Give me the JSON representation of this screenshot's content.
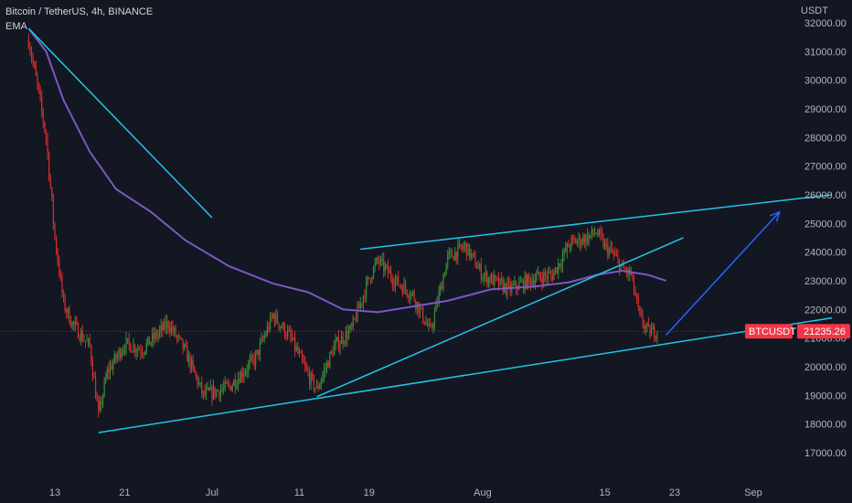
{
  "header": {
    "symbol_line": "Bitcoin / TetherUS, 4h, BINANCE",
    "indicator": "EMA"
  },
  "price_axis_unit": "USDT",
  "price_badge": {
    "symbol": "BTCUSDT",
    "price": "21235.26",
    "color": "#f23645"
  },
  "colors": {
    "background": "#131722",
    "up_candle": "#26a69a",
    "up_candle_wick": "#3a8a3a",
    "down_candle": "#d32f2f",
    "ema_line": "#7e57c2",
    "trend_lines": "#22c4e6",
    "arrow": "#2962ff"
  },
  "chart_data": {
    "type": "candlestick",
    "y_axis": {
      "ylim": [
        16200,
        32700
      ],
      "ticks": [
        "32000.00",
        "31000.00",
        "30000.00",
        "29000.00",
        "28000.00",
        "27000.00",
        "26000.00",
        "25000.00",
        "24000.00",
        "23000.00",
        "22000.00",
        "21000.00",
        "20000.00",
        "19000.00",
        "18000.00",
        "17000.00"
      ]
    },
    "x_axis": {
      "tick_labels": [
        "13",
        "21",
        "Jul",
        "11",
        "19",
        "Aug",
        "15",
        "23",
        "Sep"
      ]
    },
    "price_path": [
      {
        "t": "Jun 10",
        "p": 31400
      },
      {
        "t": "Jun 11",
        "p": 29800
      },
      {
        "t": "Jun 12",
        "p": 28000
      },
      {
        "t": "Jun 13",
        "p": 24500
      },
      {
        "t": "Jun 14",
        "p": 22200
      },
      {
        "t": "Jun 15",
        "p": 21500
      },
      {
        "t": "Jun 17",
        "p": 20700
      },
      {
        "t": "Jun 18",
        "p": 18300
      },
      {
        "t": "Jun 19",
        "p": 19800
      },
      {
        "t": "Jun 21",
        "p": 20800
      },
      {
        "t": "Jun 23",
        "p": 20600
      },
      {
        "t": "Jun 26",
        "p": 21500
      },
      {
        "t": "Jun 28",
        "p": 20500
      },
      {
        "t": "Jun 30",
        "p": 19000
      },
      {
        "t": "Jul 3",
        "p": 19300
      },
      {
        "t": "Jul 6",
        "p": 20300
      },
      {
        "t": "Jul 8",
        "p": 21800
      },
      {
        "t": "Jul 10",
        "p": 21000
      },
      {
        "t": "Jul 12",
        "p": 19700
      },
      {
        "t": "Jul 13",
        "p": 19200
      },
      {
        "t": "Jul 15",
        "p": 20700
      },
      {
        "t": "Jul 17",
        "p": 21300
      },
      {
        "t": "Jul 19",
        "p": 23100
      },
      {
        "t": "Jul 20",
        "p": 23700
      },
      {
        "t": "Jul 22",
        "p": 23000
      },
      {
        "t": "Jul 24",
        "p": 22500
      },
      {
        "t": "Jul 26",
        "p": 21200
      },
      {
        "t": "Jul 28",
        "p": 23800
      },
      {
        "t": "Jul 30",
        "p": 24200
      },
      {
        "t": "Aug 1",
        "p": 23200
      },
      {
        "t": "Aug 4",
        "p": 22700
      },
      {
        "t": "Aug 7",
        "p": 23100
      },
      {
        "t": "Aug 9",
        "p": 23200
      },
      {
        "t": "Aug 11",
        "p": 24300
      },
      {
        "t": "Aug 13",
        "p": 24500
      },
      {
        "t": "Aug 14",
        "p": 24700
      },
      {
        "t": "Aug 15",
        "p": 24200
      },
      {
        "t": "Aug 16",
        "p": 23900
      },
      {
        "t": "Aug 17",
        "p": 23400
      },
      {
        "t": "Aug 18",
        "p": 23200
      },
      {
        "t": "Aug 19",
        "p": 21700
      },
      {
        "t": "Aug 20",
        "p": 21200
      },
      {
        "t": "Aug 21",
        "p": 21235
      }
    ],
    "ema_path": [
      {
        "t": "Jun 10",
        "p": 31800
      },
      {
        "t": "Jun 12",
        "p": 31000
      },
      {
        "t": "Jun 14",
        "p": 29300
      },
      {
        "t": "Jun 17",
        "p": 27500
      },
      {
        "t": "Jun 20",
        "p": 26200
      },
      {
        "t": "Jun 24",
        "p": 25400
      },
      {
        "t": "Jun 28",
        "p": 24400
      },
      {
        "t": "Jul 3",
        "p": 23500
      },
      {
        "t": "Jul 8",
        "p": 22900
      },
      {
        "t": "Jul 12",
        "p": 22600
      },
      {
        "t": "Jul 16",
        "p": 22000
      },
      {
        "t": "Jul 20",
        "p": 21900
      },
      {
        "t": "Jul 24",
        "p": 22100
      },
      {
        "t": "Jul 28",
        "p": 22300
      },
      {
        "t": "Aug 2",
        "p": 22700
      },
      {
        "t": "Aug 7",
        "p": 22800
      },
      {
        "t": "Aug 11",
        "p": 22950
      },
      {
        "t": "Aug 14",
        "p": 23200
      },
      {
        "t": "Aug 17",
        "p": 23350
      },
      {
        "t": "Aug 20",
        "p": 23200
      },
      {
        "t": "Aug 22",
        "p": 23000
      }
    ],
    "drawings": [
      {
        "name": "descending-trendline",
        "from": {
          "t": "Jun 10",
          "p": 31800
        },
        "to": {
          "t": "Jul 1",
          "p": 25200
        }
      },
      {
        "name": "channel-upper-line",
        "from": {
          "t": "Jul 18",
          "p": 24100
        },
        "to": {
          "t": "Sep 10",
          "p": 26000
        }
      },
      {
        "name": "channel-lower-line",
        "from": {
          "t": "Jun 18",
          "p": 17700
        },
        "to": {
          "t": "Sep 10",
          "p": 21700
        }
      },
      {
        "name": "rising-support-line",
        "from": {
          "t": "Jul 13",
          "p": 18950
        },
        "to": {
          "t": "Aug 24",
          "p": 24500
        }
      },
      {
        "name": "projection-arrow",
        "from": {
          "t": "Aug 22",
          "p": 21100
        },
        "to": {
          "t": "Sep 4",
          "p": 25400
        }
      }
    ]
  }
}
